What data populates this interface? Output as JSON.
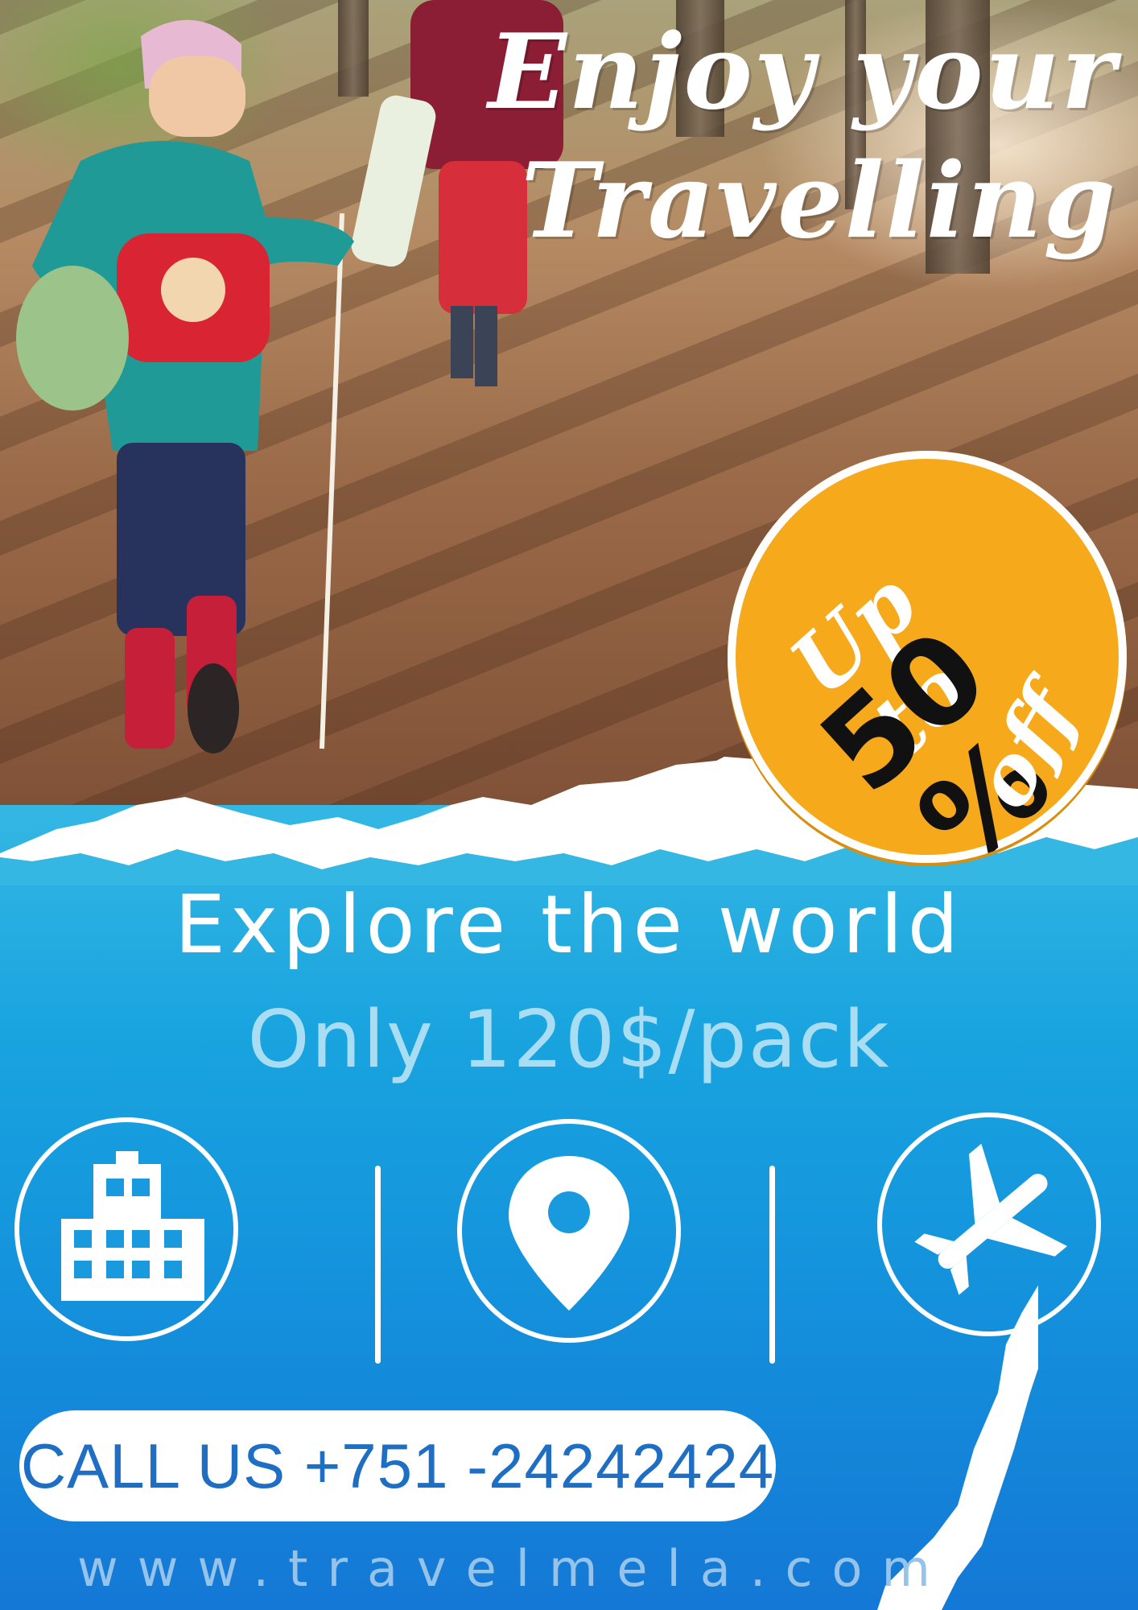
{
  "title_line1": "Enjoy your",
  "title_line2": "Travelling",
  "badge": {
    "upto": "Up to",
    "amount": "50 %",
    "off": "off",
    "color": "#f6a91a"
  },
  "headline": "Explore the world",
  "price_text": "Only 120$/pack",
  "icons": [
    "building-icon",
    "location-pin-icon",
    "airplane-icon"
  ],
  "call": "CALL US +751 -24242424",
  "website": "www.travelmela.com",
  "colors": {
    "accent_blue": "#1492dc",
    "pill_text": "#1e6fc4",
    "price_text": "#a9ddf3"
  }
}
